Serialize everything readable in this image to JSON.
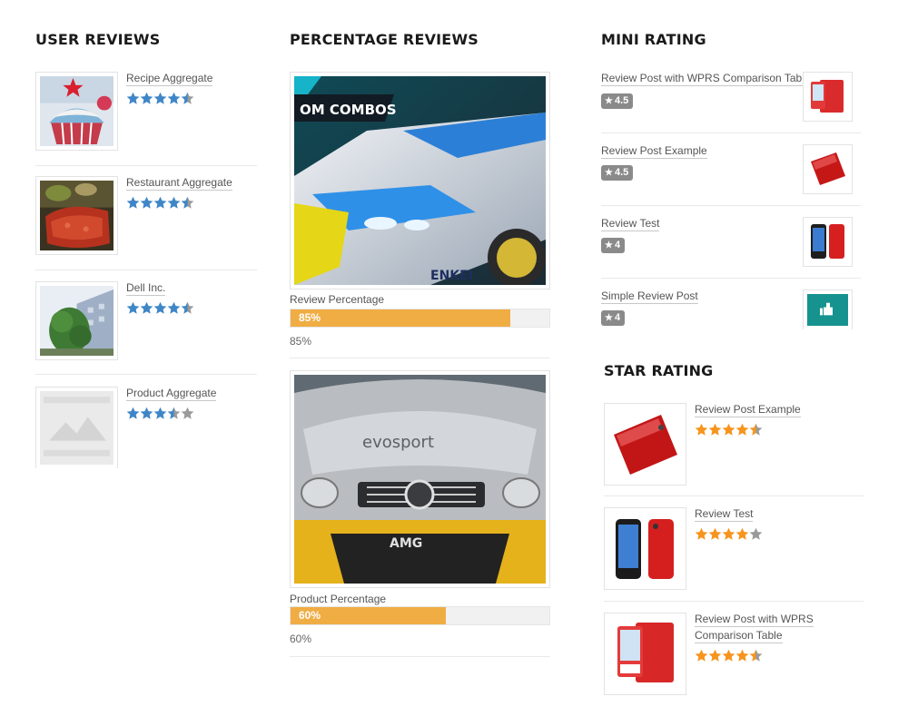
{
  "colors": {
    "blue_star": "#3f86c7",
    "orange_star": "#f7941d",
    "empty_star": "#9a9a9a",
    "progress_fill": "#f0ad44",
    "badge_bg": "#8a8a8a"
  },
  "user_reviews": {
    "title": "USER REVIEWS",
    "items": [
      {
        "name": "Recipe Aggregate",
        "rating": 4.5,
        "image": "cupcake-photo"
      },
      {
        "name": "Restaurant Aggregate",
        "rating": 4.5,
        "image": "food-photo"
      },
      {
        "name": "Dell Inc.",
        "rating": 4.5,
        "image": "building-photo"
      },
      {
        "name": "Product Aggregate",
        "rating": 3.5,
        "image": "placeholder-image"
      }
    ]
  },
  "percentage_reviews": {
    "title": "PERCENTAGE REVIEWS",
    "items": [
      {
        "label": "Review Percentage",
        "percent": 85,
        "bar_text": "85%",
        "value_text": "85%",
        "image": "race-car-photo",
        "banner": "OM COMBOS"
      },
      {
        "label": "Product Percentage",
        "percent": 60,
        "bar_text": "60%",
        "value_text": "60%",
        "image": "amg-car-photo"
      }
    ]
  },
  "mini_rating": {
    "title": "MINI RATING",
    "items": [
      {
        "name": "Review Post with WPRS Comparison Table",
        "badge": "4.5",
        "image": "red-ipod-photo"
      },
      {
        "name": "Review Post Example",
        "badge": "4.5",
        "image": "red-phone-photo"
      },
      {
        "name": "Review Test",
        "badge": "4",
        "image": "iphone-case-photo"
      },
      {
        "name": "Simple Review Post",
        "badge": "4",
        "image": "thumbs-up-photo"
      }
    ]
  },
  "star_rating": {
    "title": "STAR RATING",
    "items": [
      {
        "name": "Review Post Example",
        "rating": 4.5,
        "image": "red-phone-photo"
      },
      {
        "name": "Review Test",
        "rating": 4,
        "image": "iphone-case-photo"
      },
      {
        "name_line1": "Review Post with WPRS",
        "name_line2": "Comparison Table",
        "rating": 4.5,
        "image": "red-ipod-photo"
      }
    ]
  }
}
